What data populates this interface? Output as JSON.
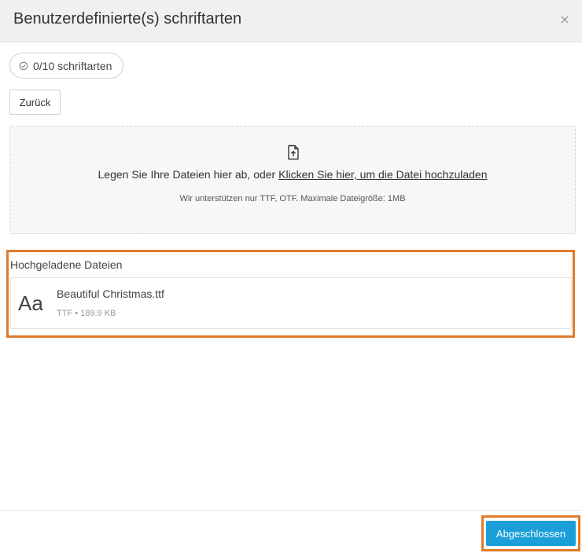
{
  "header": {
    "title": "Benutzerdefinierte(s) schriftarten",
    "close_icon": "close-icon"
  },
  "counter": {
    "icon": "check-circle-icon",
    "label": "0/10 schriftarten"
  },
  "back_button": {
    "label": "Zurück"
  },
  "dropzone": {
    "icon": "file-upload-icon",
    "text_prefix": "Legen Sie Ihre Dateien hier ab, oder ",
    "link_text": "Klicken Sie hier, um die Datei hochzuladen",
    "hint": "Wir unterstützen nur TTF, OTF. Maximale Dateigröße: 1MB"
  },
  "uploaded": {
    "title": "Hochgeladene Dateien",
    "files": [
      {
        "preview": "Aa",
        "name": "Beautiful Christmas.ttf",
        "meta": "TTF • 189.9 KB"
      }
    ]
  },
  "footer": {
    "done_label": "Abgeschlossen"
  },
  "colors": {
    "accent": "#1a9fd9",
    "highlight": "#e07b2a",
    "header_bg": "#f0f0f0"
  }
}
